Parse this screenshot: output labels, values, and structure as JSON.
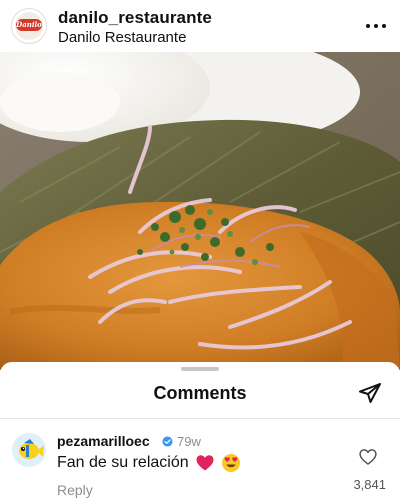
{
  "header": {
    "username": "danilo_restaurante",
    "subtitle": "Danilo Restaurante",
    "avatar_badge": "Danilo",
    "more_icon": "more-horizontal-icon"
  },
  "photo": {
    "description_icon": "food-photo"
  },
  "comments": {
    "title": "Comments",
    "share_icon": "send-icon",
    "items": [
      {
        "user": "pezamarilloec",
        "verified": true,
        "time": "79w",
        "text": "Fan de su relación",
        "emojis": [
          "red-heart",
          "heart-eyes-face"
        ],
        "reply_label": "Reply",
        "likes": "3,841",
        "like_icon": "heart-outline-icon"
      }
    ]
  },
  "colors": {
    "brand_badge": "#d23b2b",
    "muted_text": "#8e8e8e",
    "verified_blue": "#3897f0",
    "heart_red": "#e0245e"
  }
}
